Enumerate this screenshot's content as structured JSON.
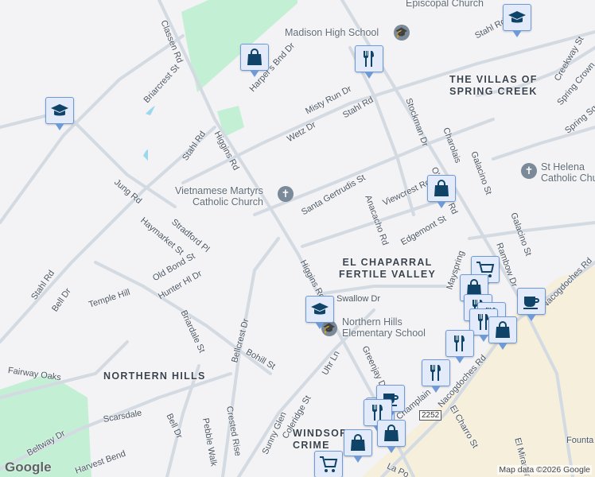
{
  "map": {
    "labels": [
      "Classen Rd",
      "Briarcrest St",
      "Stahl Rd",
      "Higgins Rd",
      "Harper's Bnd Dr",
      "Misty Run Dr",
      "Stahl Rd",
      "Wetz Dr",
      "Creekway St",
      "Spring Crown",
      "Spring Square",
      "Stockman Dr",
      "Charolais",
      "Galacino St",
      "O'Connor Rd",
      "Santa Gertrudis St",
      "Viewcrest Rd",
      "Anacacho Rd",
      "Jung Rd",
      "Haymarket St",
      "Stradford Pl",
      "Edgemont St",
      "Galacino St",
      "Rambow Dr",
      "Old Bond St",
      "Hunter Hl Dr",
      "Higgins Rd",
      "Mayspring",
      "Stahl Rd",
      "Bell Dr",
      "Temple Hill",
      "Briardale St",
      "Bellcrest Dr",
      "Bohill St",
      "Swallow Dr",
      "Nacogdoches Rd",
      "Nacogdoches Rd",
      "Uhr Ln",
      "Greenjay Dr",
      "Fairway Oaks",
      "Scarsdale",
      "Bell Dr",
      "Beltway Dr",
      "Harvest Bend",
      "Crested Rise",
      "Pebble Walk",
      "Sunny Glen",
      "Coleridge St",
      "El Charro St",
      "El Mirador",
      "Founta",
      "La Po",
      "Stahl Rd",
      "Champlain"
    ],
    "pois": {
      "madison": "Madison High School",
      "episcopal": "Episcopal Church",
      "vietnamese": "Vietnamese Martyrs\nCatholic Church",
      "sthelena": "St Helena\nCatholic Church",
      "northernhills_school": "Northern Hills\nElementary School"
    },
    "areas": {
      "villas": "THE VILLAS OF\nSPRING CREEK",
      "chaparral": "EL CHAPARRAL\nFERTILE VALLEY",
      "northernhills": "NORTHERN HILLS",
      "windsor": "WINDSOR\nCRIME"
    },
    "route_shield": "2252",
    "attribution": "Map data ©2026 Google",
    "logo": "Google",
    "markers": [
      "school",
      "shopping",
      "restaurant",
      "school",
      "shopping",
      "grocery",
      "shopping",
      "restaurant",
      "restaurant",
      "restaurant",
      "shopping",
      "coffee",
      "school",
      "restaurant",
      "restaurant",
      "restaurant",
      "coffee",
      "restaurant",
      "shopping",
      "shopping",
      "grocery"
    ]
  }
}
